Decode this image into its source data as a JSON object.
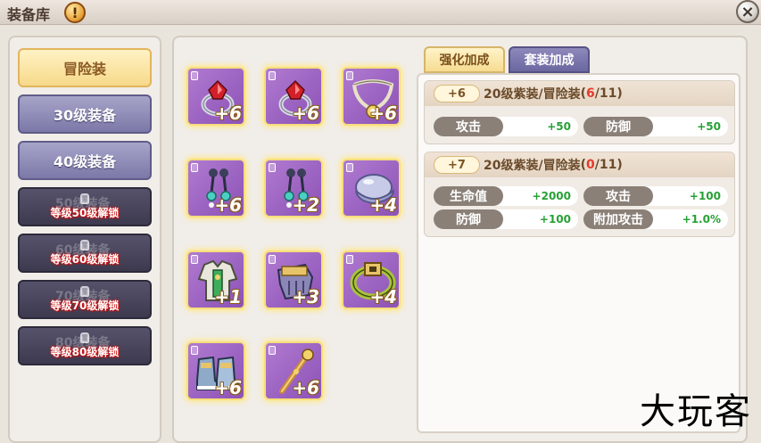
{
  "window": {
    "title": "装备库",
    "info_icon": "!",
    "close_icon": "×"
  },
  "categories": [
    {
      "label": "冒险装",
      "state": "active"
    },
    {
      "label": "30级装备",
      "state": "normal"
    },
    {
      "label": "40级装备",
      "state": "normal"
    },
    {
      "label": "50级装备",
      "state": "locked",
      "lock_text": "等级50级解锁"
    },
    {
      "label": "60级装备",
      "state": "locked",
      "lock_text": "等级60级解锁"
    },
    {
      "label": "70级装备",
      "state": "locked",
      "lock_text": "等级70级解锁"
    },
    {
      "label": "80级装备",
      "state": "locked",
      "lock_text": "等级80级解锁"
    }
  ],
  "equipment": [
    {
      "icon": "ring-red-gem-icon",
      "level": "+6"
    },
    {
      "icon": "ring-red-gem-icon",
      "level": "+6"
    },
    {
      "icon": "necklace-icon",
      "level": "+6"
    },
    {
      "icon": "earring-icon",
      "level": "+6"
    },
    {
      "icon": "earring-icon",
      "level": "+2"
    },
    {
      "icon": "hat-icon",
      "level": "+4"
    },
    {
      "icon": "armor-icon",
      "level": "+1"
    },
    {
      "icon": "gloves-icon",
      "level": "+3"
    },
    {
      "icon": "belt-icon",
      "level": "+4"
    },
    {
      "icon": "boots-icon",
      "level": "+6"
    },
    {
      "icon": "staff-icon",
      "level": "+6"
    }
  ],
  "tabs": {
    "enhance": "强化加成",
    "set": "套装加成"
  },
  "bonuses": [
    {
      "plus": "+6",
      "label": "20级紫装/冒险装",
      "count": "6",
      "total": "/11)",
      "open": "(",
      "stats": [
        {
          "name": "攻击",
          "value": "+50"
        },
        {
          "name": "防御",
          "value": "+50"
        }
      ]
    },
    {
      "plus": "+7",
      "label": "20级紫装/冒险装",
      "count": "0",
      "total": "/11)",
      "open": "(",
      "stats": [
        {
          "name": "生命值",
          "value": "+2000"
        },
        {
          "name": "攻击",
          "value": "+100"
        },
        {
          "name": "防御",
          "value": "+100"
        },
        {
          "name": "附加攻击",
          "value": "+1.0%"
        }
      ]
    }
  ],
  "watermark": "大玩客",
  "colors": {
    "slot_purple": "#9a62c0",
    "slot_glow": "#f7de7b",
    "stat_green": "#27a135",
    "count_red": "#e53a2b"
  }
}
